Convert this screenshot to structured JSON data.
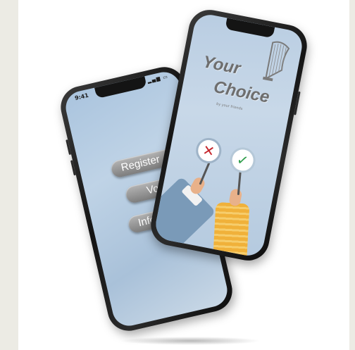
{
  "back_phone": {
    "status_time": "9:41",
    "status_icons": "▂▄▆ ▭",
    "buttons": {
      "register": "Register",
      "vote": "Vote",
      "inform": "Inform"
    }
  },
  "front_phone": {
    "title_line1": "Your",
    "title_line2": "Choice",
    "subtitle": "by your friends",
    "signs": {
      "reject": "✕",
      "approve": "✓"
    }
  },
  "colors": {
    "screen_blue": "#b9cde2",
    "button_gray": "#8e8e8e",
    "reject_red": "#c5262c",
    "approve_green": "#2e9d4a"
  }
}
